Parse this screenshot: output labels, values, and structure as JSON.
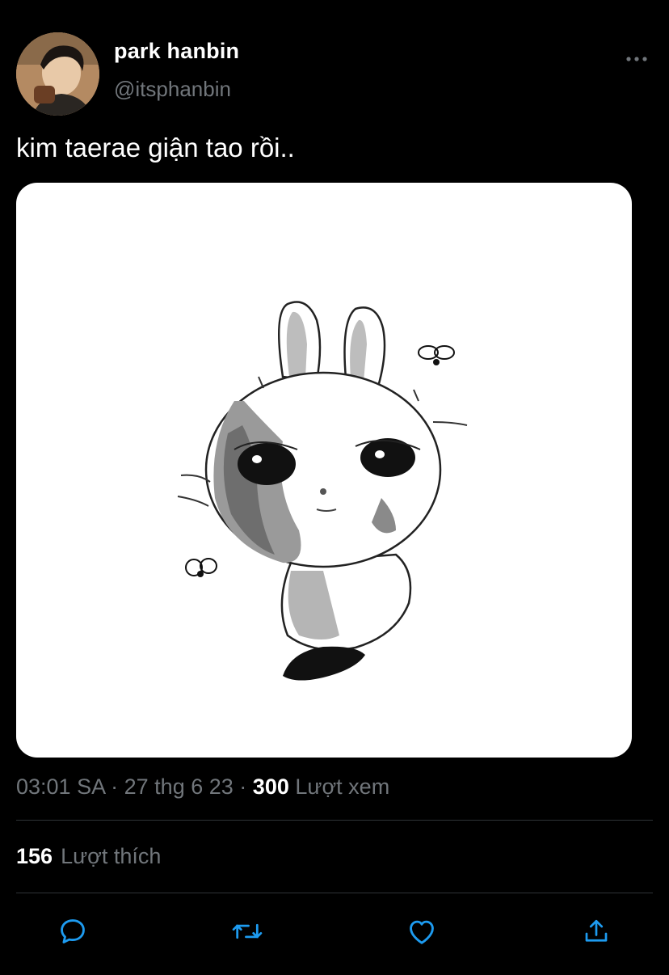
{
  "author": {
    "display_name": "park hanbin",
    "handle": "@itsphanbin",
    "avatar_icon": "profile-photo"
  },
  "tweet": {
    "text": "kim taerae giận tao rồi..",
    "media_icon": "bunny-sticker-illustration"
  },
  "meta": {
    "time": "03:01 SA",
    "separator": "·",
    "date": "27 thg 6 23",
    "views_count": "300",
    "views_label": "Lượt xem"
  },
  "engagement": {
    "likes_count": "156",
    "likes_label": "Lượt thích"
  },
  "actions": [
    {
      "icon": "reply-icon"
    },
    {
      "icon": "retweet-icon"
    },
    {
      "icon": "like-icon"
    },
    {
      "icon": "share-icon"
    }
  ],
  "colors": {
    "background": "#000000",
    "primary_text": "#ffffff",
    "secondary_text": "#71767b",
    "divider": "#2f3336",
    "icon": "#1d9bf0"
  }
}
